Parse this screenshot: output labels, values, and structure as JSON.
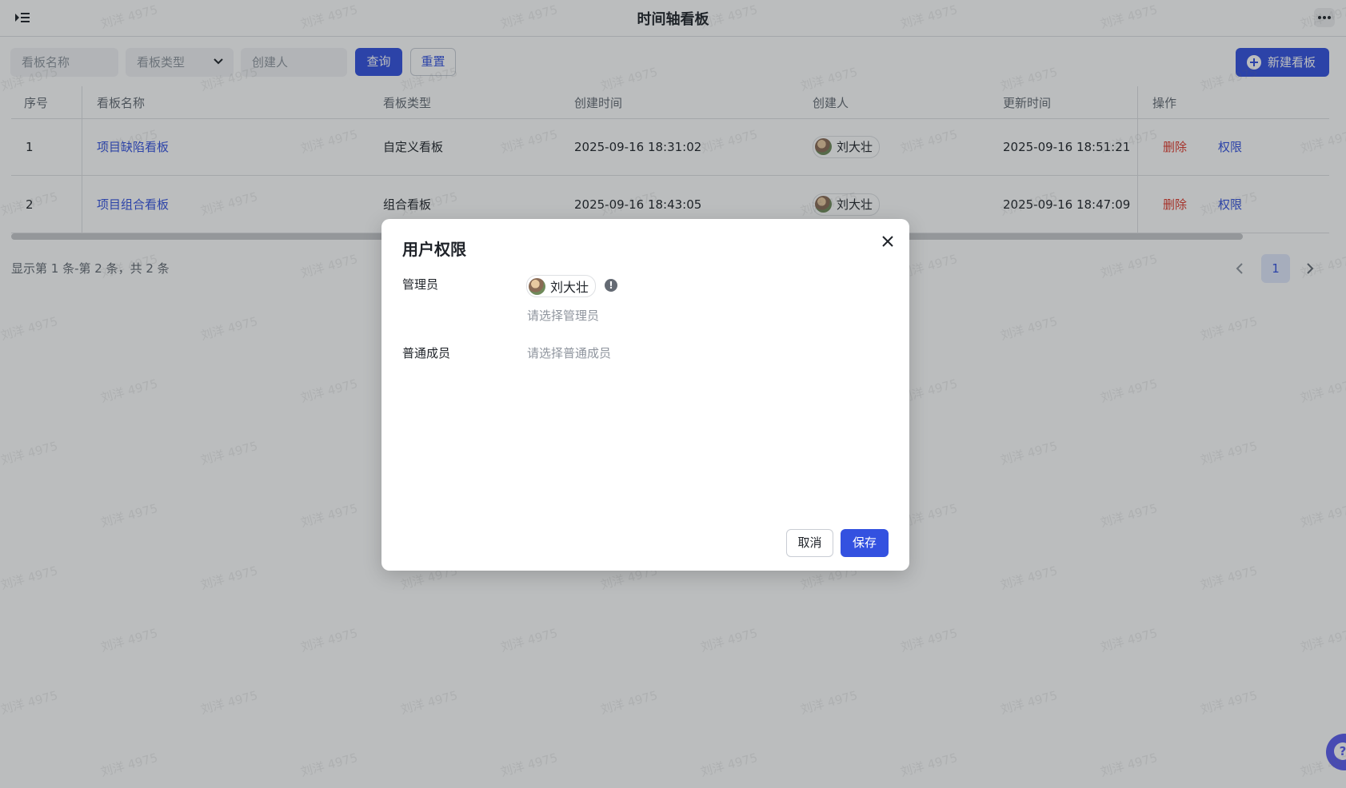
{
  "header": {
    "title": "时间轴看板"
  },
  "filters": {
    "name_placeholder": "看板名称",
    "type_placeholder": "看板类型",
    "creator_placeholder": "创建人",
    "query_label": "查询",
    "reset_label": "重置",
    "new_label": "新建看板"
  },
  "table": {
    "columns": [
      "序号",
      "看板名称",
      "看板类型",
      "创建时间",
      "创建人",
      "更新时间",
      "操作"
    ],
    "rows": [
      {
        "index": "1",
        "name": "项目缺陷看板",
        "type": "自定义看板",
        "created_at": "2025-09-16 18:31:02",
        "creator": "刘大壮",
        "updated_at": "2025-09-16 18:51:21",
        "action_delete": "删除",
        "action_permission": "权限"
      },
      {
        "index": "2",
        "name": "项目组合看板",
        "type": "组合看板",
        "created_at": "2025-09-16 18:43:05",
        "creator": "刘大壮",
        "updated_at": "2025-09-16 18:47:09",
        "action_delete": "删除",
        "action_permission": "权限"
      }
    ]
  },
  "pagination": {
    "summary": "显示第 1 条-第 2 条，共 2 条",
    "current_page": "1"
  },
  "watermark": {
    "text": "刘洋 4975"
  },
  "modal": {
    "title": "用户权限",
    "admin_label": "管理员",
    "admin_user": "刘大壮",
    "admin_placeholder": "请选择管理员",
    "member_label": "普通成员",
    "member_placeholder": "请选择普通成员",
    "cancel_label": "取消",
    "save_label": "保存"
  },
  "colors": {
    "primary": "#3351e0",
    "danger": "#e0382b",
    "mask": "rgba(31,35,41,0.30)"
  },
  "icons": [
    "menu-collapse-icon",
    "more-icon",
    "chevron-down-icon",
    "plus-circle-icon",
    "chevron-left-icon",
    "chevron-right-icon",
    "close-icon",
    "warning-icon",
    "help-icon"
  ]
}
